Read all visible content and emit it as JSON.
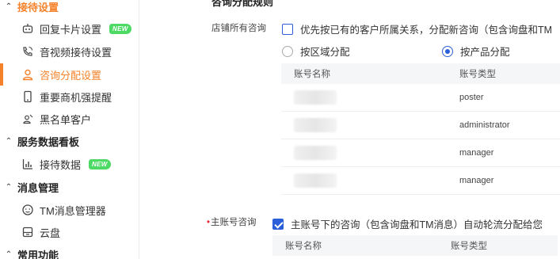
{
  "sidebar": {
    "groups": [
      {
        "label": "接待设置"
      },
      {
        "label": "服务数据看板"
      },
      {
        "label": "消息管理"
      },
      {
        "label": "常用功能"
      }
    ],
    "items": [
      {
        "label": "回复卡片设置",
        "badge": "NEW",
        "icon": "robot-icon"
      },
      {
        "label": "音视频接待设置",
        "icon": "phone-icon"
      },
      {
        "label": "咨询分配设置",
        "icon": "user-icon",
        "active": true
      },
      {
        "label": "重要商机强提醒",
        "icon": "phone-device-icon"
      },
      {
        "label": "黑名单客户",
        "icon": "blocked-user-icon"
      },
      {
        "label": "接待数据",
        "badge": "NEW",
        "icon": "bar-chart-icon"
      },
      {
        "label": "TM消息管理器",
        "icon": "message-icon"
      },
      {
        "label": "云盘",
        "icon": "cloud-drive-icon"
      }
    ]
  },
  "main": {
    "section_title": "咨询分配规则",
    "store_label": "店铺所有咨询",
    "store_checkbox_label": "优先按已有的客户所属关系，分配新咨询（包含询盘和TM",
    "radio_region": "按区域分配",
    "radio_product": "按产品分配",
    "table1": {
      "headers": [
        "账号名称",
        "账号类型"
      ],
      "rows": [
        {
          "name": "",
          "type": "poster"
        },
        {
          "name": "",
          "type": "administrator"
        },
        {
          "name": "",
          "type": "manager"
        },
        {
          "name": "",
          "type": "manager"
        }
      ]
    },
    "sub_label": "主账号咨询",
    "sub_checkbox_label": "主账号下的咨询（包含询盘和TM消息）自动轮流分配给您",
    "table2": {
      "headers": [
        "账号名称",
        "账号类型"
      ]
    }
  },
  "colors": {
    "accent": "#f5822a",
    "primary": "#2b5fd9",
    "badge": "#4cd964"
  }
}
